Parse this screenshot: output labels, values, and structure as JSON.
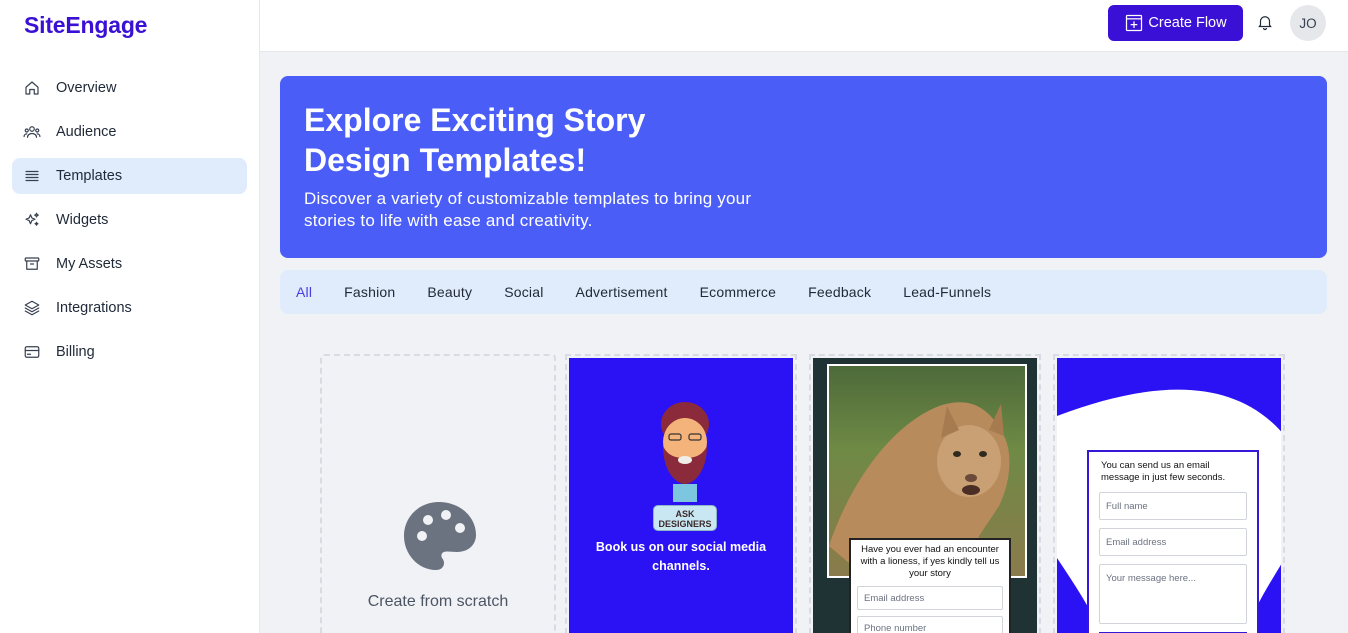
{
  "brand": "SiteEngage",
  "sidebar": {
    "items": [
      {
        "label": "Overview",
        "icon": "home-icon"
      },
      {
        "label": "Audience",
        "icon": "users-icon"
      },
      {
        "label": "Templates",
        "icon": "list-icon",
        "active": true
      },
      {
        "label": "Widgets",
        "icon": "sparkles-icon"
      },
      {
        "label": "My Assets",
        "icon": "archive-icon"
      },
      {
        "label": "Integrations",
        "icon": "layers-icon"
      },
      {
        "label": "Billing",
        "icon": "credit-card-icon"
      }
    ]
  },
  "header": {
    "create_label": "Create Flow",
    "avatar_initials": "JO"
  },
  "hero": {
    "title": "Explore Exciting Story Design Templates!",
    "subtitle": "Discover a variety of customizable templates to bring your stories to life with ease and creativity."
  },
  "tabs": [
    "All",
    "Fashion",
    "Beauty",
    "Social",
    "Advertisement",
    "Ecommerce",
    "Feedback",
    "Lead-Funnels"
  ],
  "active_tab": "All",
  "scratch": {
    "label": "Create from scratch",
    "icon": "palette-icon"
  },
  "templates": {
    "t1": {
      "badge": "ASK DESIGNERS",
      "text": "Book us on our social media channels."
    },
    "t2": {
      "question": "Have you ever had an encounter with a lioness, if yes kindly tell us your story",
      "email_placeholder": "Email address",
      "phone_placeholder": "Phone number"
    },
    "t3": {
      "message": "You can send us an email message in just few seconds.",
      "name_placeholder": "Full name",
      "email_placeholder": "Email address",
      "message_placeholder": "Your message here..."
    }
  },
  "colors": {
    "brand": "#3b10d6",
    "hero": "#4a5ef7",
    "tabs_bg": "#e0ebfb",
    "active_tab": "#4a3de0"
  }
}
